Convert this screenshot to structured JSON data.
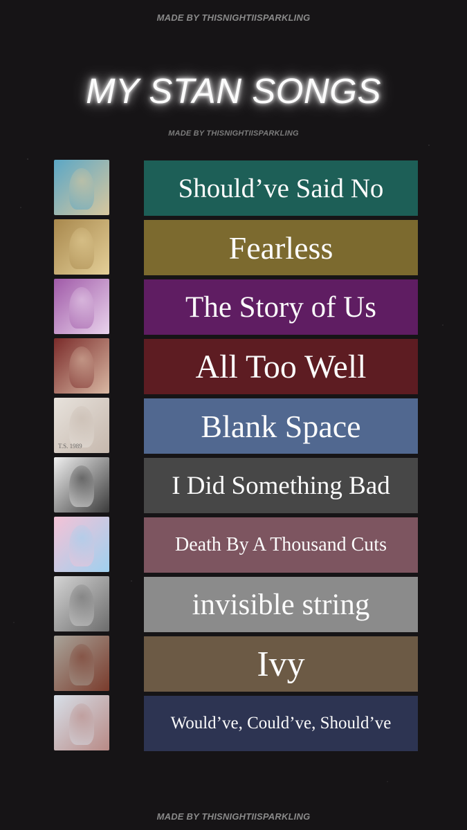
{
  "credit_top": "MADE BY THISNIGHTIISPARKLING",
  "title": "MY STAN SONGS",
  "credit_sub": "MADE BY THISNIGHTIISPARKLING",
  "credit_bottom": "MADE BY THISNIGHTIISPARKLING",
  "songs": [
    {
      "title": "Should’ve Said No",
      "color": "#1d5f57",
      "cover_colors": [
        "#5ba7c6",
        "#d8c79e"
      ]
    },
    {
      "title": "Fearless",
      "color": "#7c6a2f",
      "cover_colors": [
        "#a8884d",
        "#e4cf98"
      ]
    },
    {
      "title": "The Story of Us",
      "color": "#5f1d62",
      "cover_colors": [
        "#a05aa8",
        "#e9d3ec"
      ]
    },
    {
      "title": "All Too Well",
      "color": "#5d1c22",
      "cover_colors": [
        "#7a2b2a",
        "#d9b8a3"
      ]
    },
    {
      "title": "Blank Space",
      "color": "#516890",
      "cover_colors": [
        "#e7e2dc",
        "#c6b8ad"
      ]
    },
    {
      "title": "I Did Something Bad",
      "color": "#474747",
      "cover_colors": [
        "#f0f0f0",
        "#3a3a3a"
      ]
    },
    {
      "title": "Death By A Thousand Cuts",
      "color": "#7d5560",
      "cover_colors": [
        "#f4c2d6",
        "#9fd0ef"
      ]
    },
    {
      "title": "invisible string",
      "color": "#8b8b8b",
      "cover_colors": [
        "#d4d4d4",
        "#6c6c6c"
      ]
    },
    {
      "title": "Ivy",
      "color": "#6c5a45",
      "cover_colors": [
        "#a9a49a",
        "#7a3b2c"
      ]
    },
    {
      "title": "Would’ve, Could’ve, Should’ve",
      "color": "#2d3452",
      "cover_colors": [
        "#d7dfe8",
        "#b88a86"
      ]
    }
  ]
}
